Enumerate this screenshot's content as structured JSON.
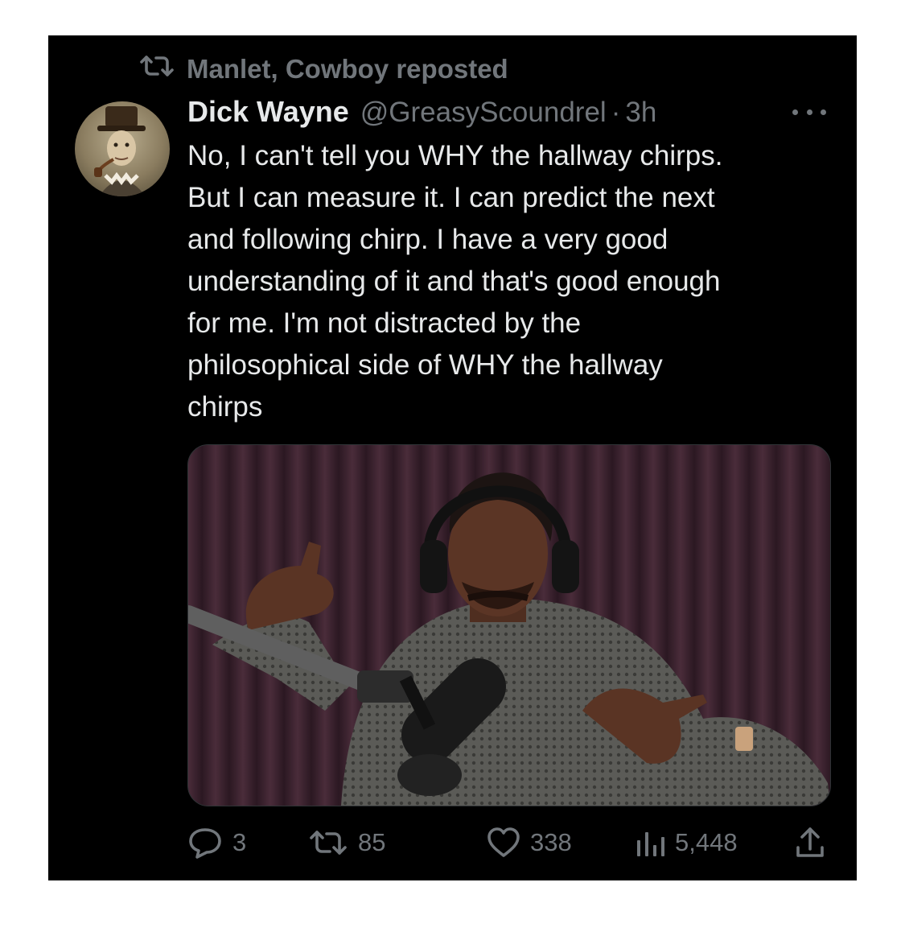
{
  "repost": {
    "text": "Manlet, Cowboy reposted",
    "icon": "repost-icon"
  },
  "tweet": {
    "author_name": "Dick Wayne",
    "handle": "@GreasyScoundrel",
    "separator": "·",
    "time": "3h",
    "text": "No, I can't tell you WHY the hallway chirps.\nBut I can measure it. I can predict the next\nand following chirp. I have a very good\nunderstanding of it and that's good enough\nfor me. I'm not distracted by the\nphilosophical side of WHY the hallway\nchirps"
  },
  "actions": {
    "replies": "3",
    "reposts": "85",
    "likes": "338",
    "views": "5,448",
    "icons": [
      "reply-icon",
      "repost-icon",
      "like-icon",
      "views-icon",
      "share-icon"
    ]
  },
  "colors": {
    "background": "#000000",
    "text_primary": "#e7e9ea",
    "text_secondary": "#71767b",
    "page_frame": "#ffffff"
  }
}
